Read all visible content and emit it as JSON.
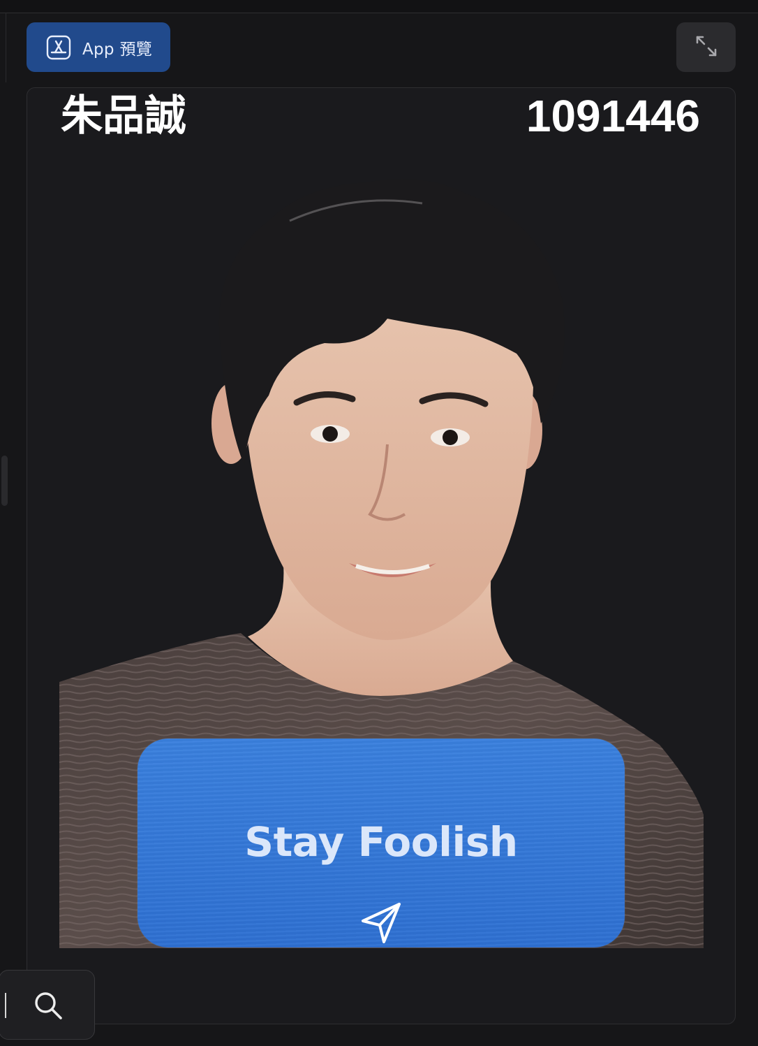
{
  "toolbar": {
    "preview_label": "App 預覽",
    "preview_icon": "app-store-icon",
    "expand_icon": "expand-arrows-icon"
  },
  "card": {
    "name": "朱品誠",
    "student_id": "1091446",
    "action_title": "Stay Foolish",
    "action_icon": "paper-plane-send-icon",
    "accent_color": "#3478d6"
  },
  "search": {
    "icon": "search-icon"
  }
}
